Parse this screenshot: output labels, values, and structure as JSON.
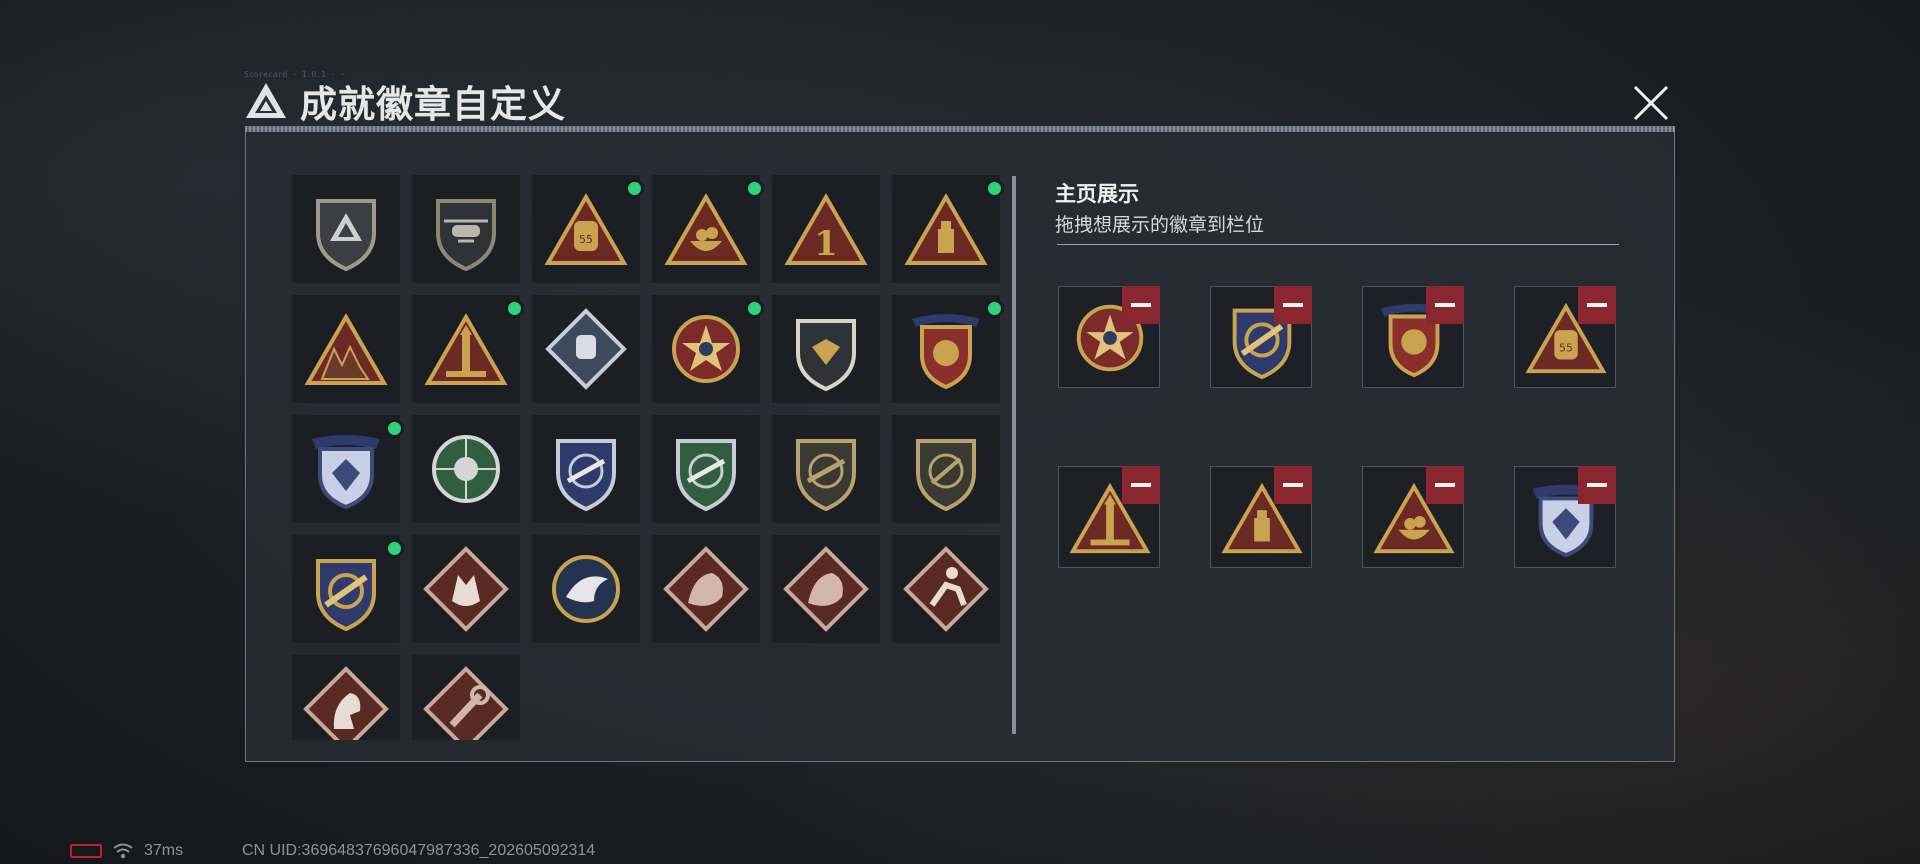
{
  "header": {
    "title": "成就徽章自定义",
    "tiny_caption": "Scorecard  · 1.0.1  ·  ·"
  },
  "close": {
    "icon": "close-icon"
  },
  "badges": [
    {
      "icon": "shield-logo-badge-icon",
      "new": false
    },
    {
      "icon": "helicopter-badge-icon",
      "new": false
    },
    {
      "icon": "bag-55-triangle-badge-icon",
      "new": true
    },
    {
      "icon": "bowl-triangle-badge-icon",
      "new": true
    },
    {
      "icon": "number-1-triangle-badge-icon",
      "new": false
    },
    {
      "icon": "usb-triangle-badge-icon",
      "new": true
    },
    {
      "icon": "soldiers-triangle-badge-icon",
      "new": false
    },
    {
      "icon": "rocket-triangle-badge-icon",
      "new": true
    },
    {
      "icon": "fist-diamond-badge-icon",
      "new": false
    },
    {
      "icon": "star-emblem-badge-icon",
      "new": true
    },
    {
      "icon": "wing-shield-badge-icon",
      "new": false
    },
    {
      "icon": "banner-emblem-badge-icon",
      "new": true
    },
    {
      "icon": "diamond-shield-badge-icon",
      "new": true
    },
    {
      "icon": "skull-crosshair-badge-icon",
      "new": false
    },
    {
      "icon": "rifle-blue-shield-badge-icon",
      "new": false
    },
    {
      "icon": "rifle-green-shield-badge-icon",
      "new": false
    },
    {
      "icon": "rifle-dark-shield-badge-icon",
      "new": false
    },
    {
      "icon": "knife-dark-shield-badge-icon",
      "new": false
    },
    {
      "icon": "crossed-gold-shield-badge-icon",
      "new": true
    },
    {
      "icon": "wolf-diamond-badge-icon",
      "new": false
    },
    {
      "icon": "eagle-circle-badge-icon",
      "new": false
    },
    {
      "icon": "dragon-diamond-badge-icon",
      "new": false
    },
    {
      "icon": "dragon-diamond-2-badge-icon",
      "new": false
    },
    {
      "icon": "runner-diamond-badge-icon",
      "new": false
    },
    {
      "icon": "horse-diamond-badge-icon",
      "new": false
    },
    {
      "icon": "wrench-diamond-badge-icon",
      "new": false
    }
  ],
  "display": {
    "title": "主页展示",
    "subtitle": "拖拽想展示的徽章到栏位",
    "slots": [
      {
        "icon": "star-emblem-badge-icon"
      },
      {
        "icon": "crossed-gold-shield-badge-icon"
      },
      {
        "icon": "banner-emblem-badge-icon"
      },
      {
        "icon": "bag-55-triangle-badge-icon"
      },
      {
        "icon": "rocket-triangle-badge-icon"
      },
      {
        "icon": "usb-triangle-badge-icon"
      },
      {
        "icon": "bowl-triangle-badge-icon"
      },
      {
        "icon": "diamond-shield-badge-icon"
      }
    ]
  },
  "status": {
    "ping": "37ms",
    "uid": "CN UID:36964837696047987336_202605092314"
  },
  "colors": {
    "gold": "#c9a34f",
    "maroon": "#6b2a24",
    "new_dot": "#2fd27a",
    "remove": "#8a2630"
  }
}
